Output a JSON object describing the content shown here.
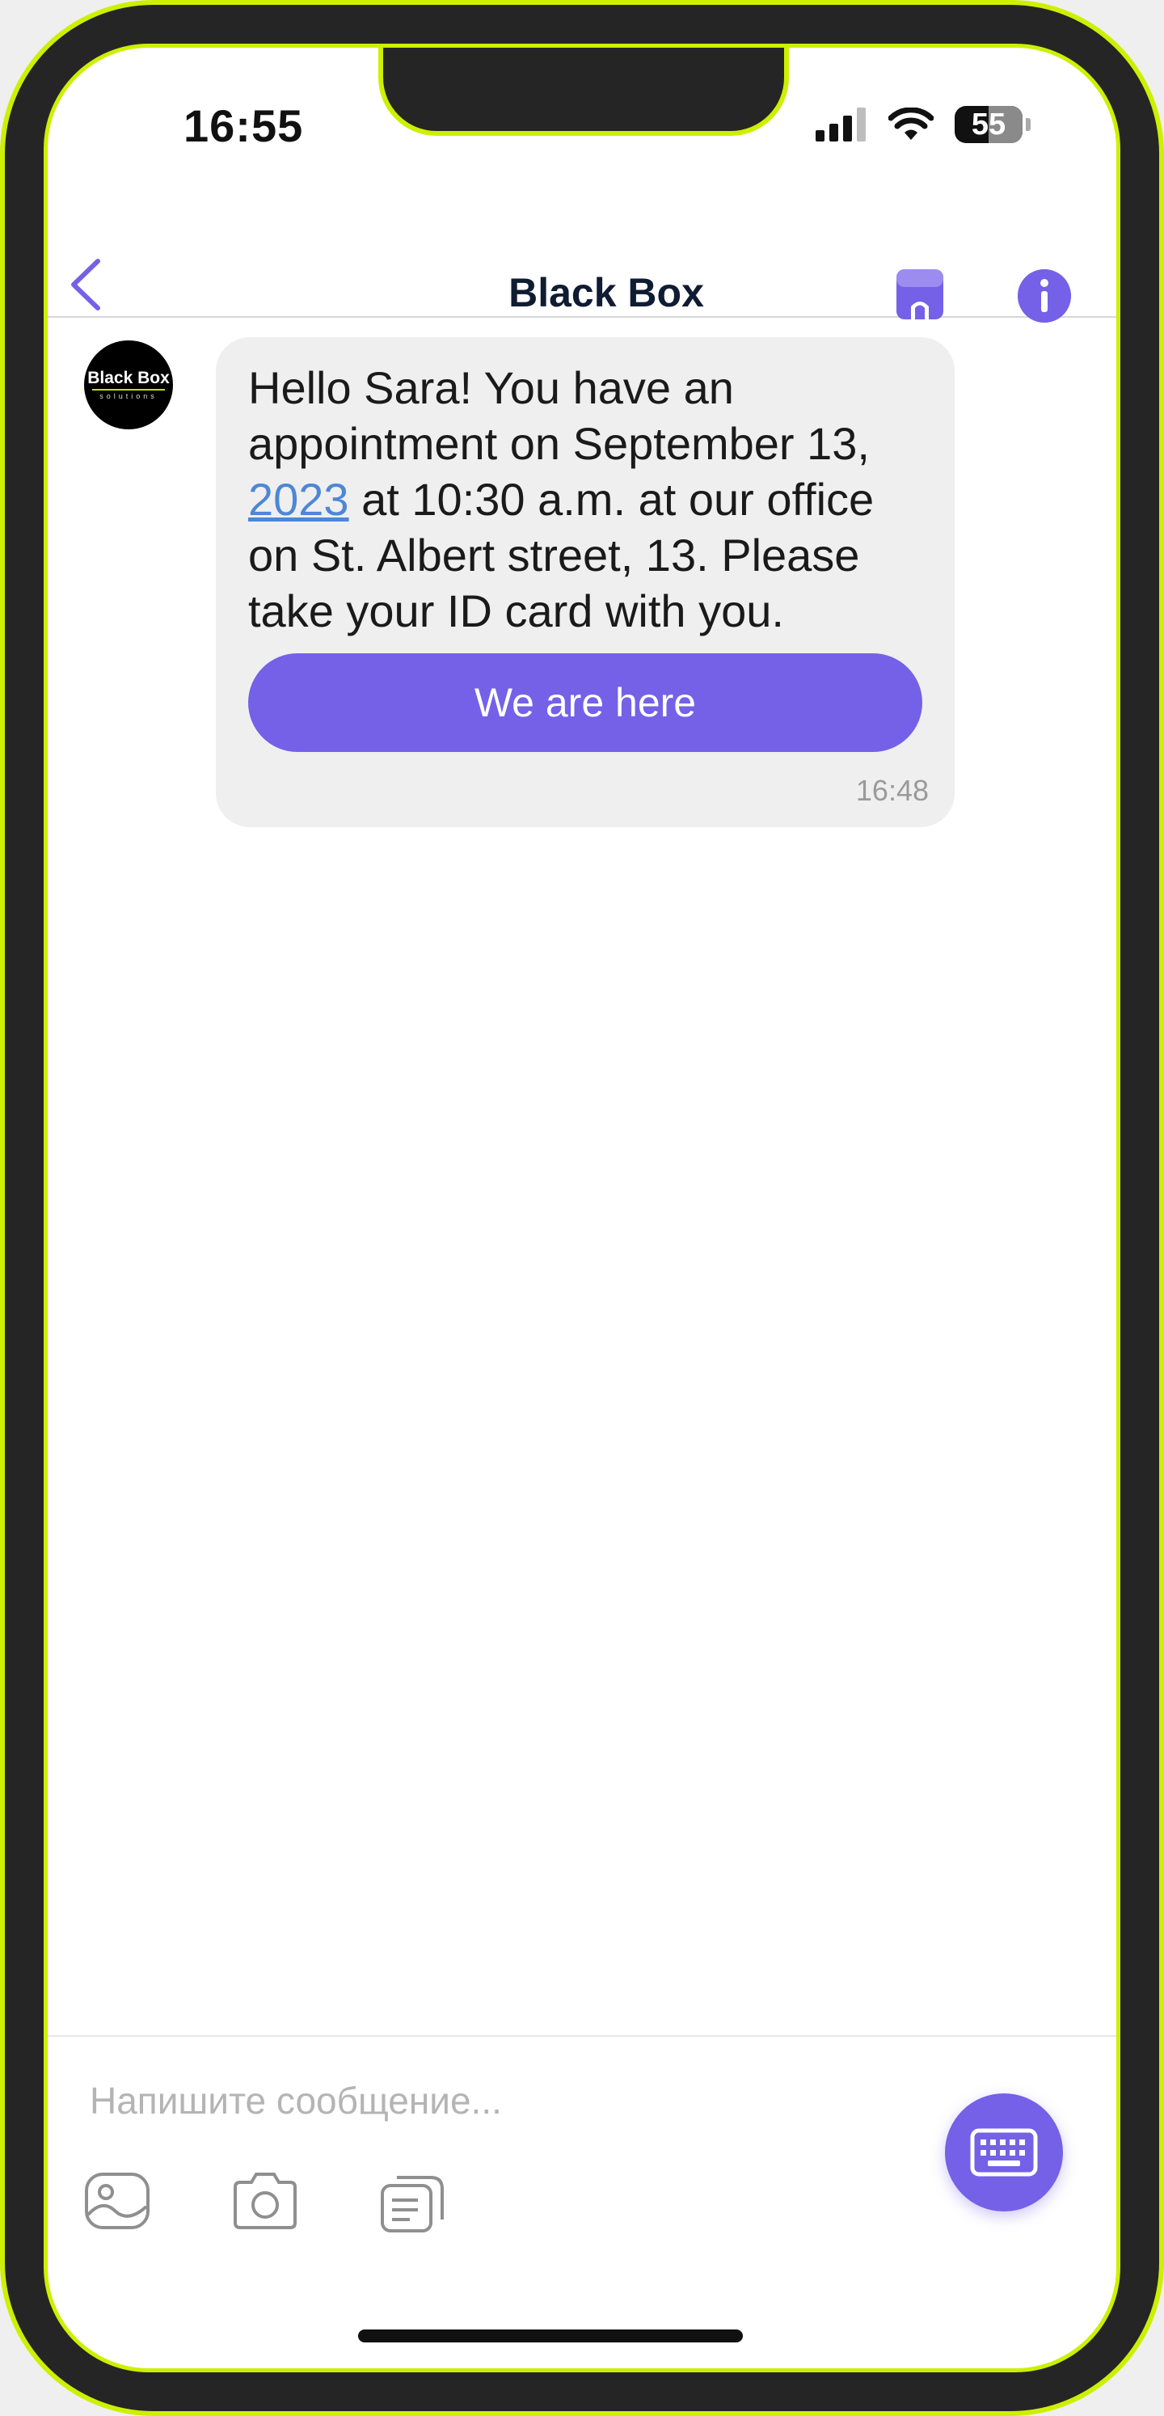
{
  "status_bar": {
    "time": "16:55",
    "battery": "55"
  },
  "header": {
    "title": "Black Box"
  },
  "avatar": {
    "line1": "Black Box",
    "line2": "solutions"
  },
  "message": {
    "text_before": "Hello Sara! You have an appointment on September 13, ",
    "link": "2023",
    "text_after": " at 10:30 a.m. at our office on St. Albert street, 13. Please take your ID card with you.",
    "button": "We are here",
    "time": "16:48"
  },
  "composer": {
    "placeholder": "Напишите сообщение..."
  },
  "colors": {
    "accent": "#7560e8",
    "frame": "#cdf000",
    "link": "#4d87d6",
    "bubble": "#efefef"
  }
}
